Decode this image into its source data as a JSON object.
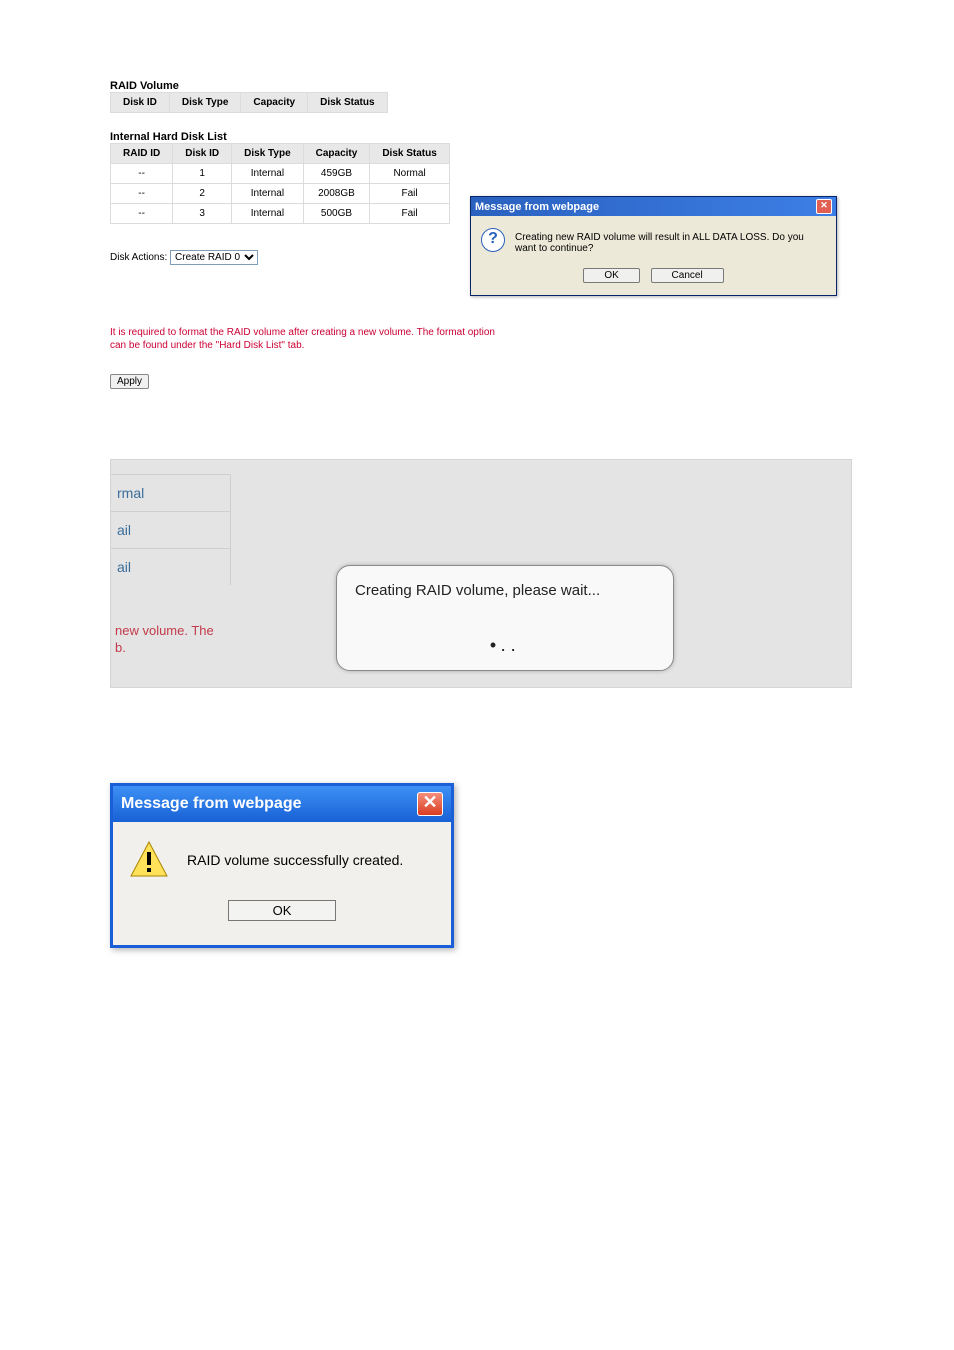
{
  "raid_volume": {
    "title": "RAID Volume",
    "headers": {
      "disk_id": "Disk ID",
      "disk_type": "Disk Type",
      "capacity": "Capacity",
      "disk_status": "Disk Status"
    }
  },
  "disk_list": {
    "title": "Internal Hard Disk List",
    "headers": {
      "raid_id": "RAID ID",
      "disk_id": "Disk ID",
      "disk_type": "Disk Type",
      "capacity": "Capacity",
      "disk_status": "Disk Status"
    },
    "rows": [
      {
        "raid_id": "--",
        "disk_id": "1",
        "disk_type": "Internal",
        "capacity": "459GB",
        "disk_status": "Normal"
      },
      {
        "raid_id": "--",
        "disk_id": "2",
        "disk_type": "Internal",
        "capacity": "2008GB",
        "disk_status": "Fail"
      },
      {
        "raid_id": "--",
        "disk_id": "3",
        "disk_type": "Internal",
        "capacity": "500GB",
        "disk_status": "Fail"
      }
    ]
  },
  "disk_actions": {
    "label": "Disk Actions:",
    "selected": "Create RAID 0"
  },
  "format_warning": "It is required to format the RAID volume after creating a new volume. The format option can be found under the \"Hard Disk List\" tab.",
  "apply_label": "Apply",
  "confirm_dialog": {
    "title": "Message from webpage",
    "message": "Creating new RAID volume will result in ALL DATA LOSS. Do you want to continue?",
    "ok": "OK",
    "cancel": "Cancel"
  },
  "progress_panel": {
    "left_labels": [
      "rmal",
      "ail",
      "ail"
    ],
    "dialog_text": "Creating RAID volume, please wait...",
    "note_line1": "new volume. The",
    "note_line2": "b."
  },
  "success_dialog": {
    "title": "Message from webpage",
    "message": "RAID volume successfully created.",
    "ok": "OK"
  }
}
